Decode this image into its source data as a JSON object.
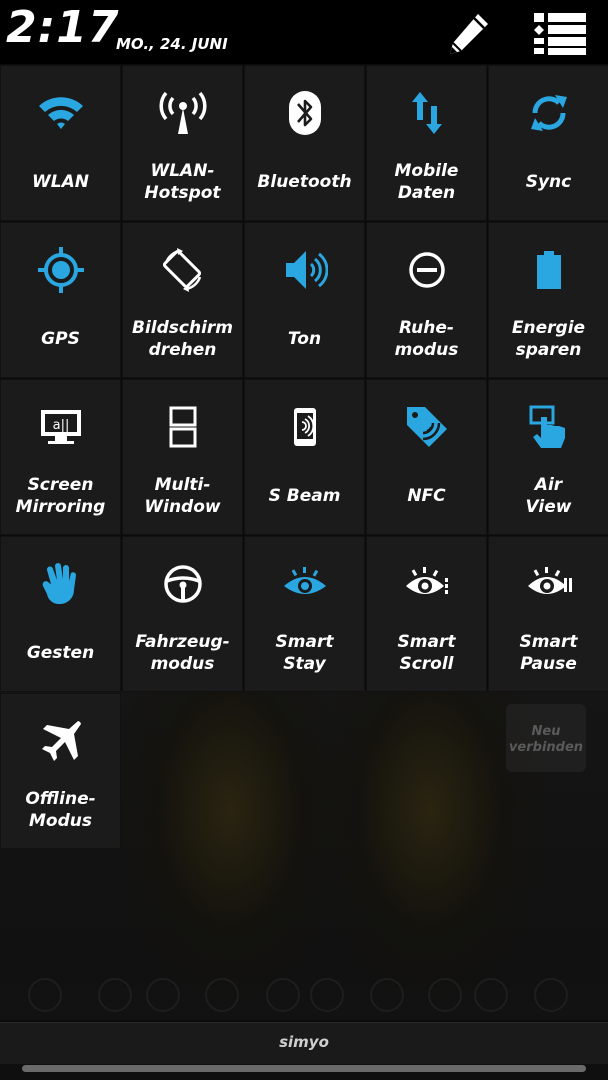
{
  "status": {
    "time": "2:17",
    "date": "MO., 24. JUNI"
  },
  "colors": {
    "accent": "#2aa6e0",
    "icon_white": "#ffffff",
    "tile_bg": "#1b1b1b"
  },
  "toggles": [
    {
      "label": "WLAN",
      "icon": "wifi-icon",
      "active": true
    },
    {
      "label": "WLAN-\nHotspot",
      "icon": "hotspot-icon",
      "active": false
    },
    {
      "label": "Bluetooth",
      "icon": "bluetooth-icon",
      "active": false
    },
    {
      "label": "Mobile\nDaten",
      "icon": "mobile-data-icon",
      "active": true
    },
    {
      "label": "Sync",
      "icon": "sync-icon",
      "active": true
    },
    {
      "label": "GPS",
      "icon": "gps-icon",
      "active": true
    },
    {
      "label": "Bildschirm\ndrehen",
      "icon": "rotate-icon",
      "active": false
    },
    {
      "label": "Ton",
      "icon": "sound-icon",
      "active": true
    },
    {
      "label": "Ruhe-\nmodus",
      "icon": "blocking-mode-icon",
      "active": false
    },
    {
      "label": "Energie\nsparen",
      "icon": "battery-icon",
      "active": true
    },
    {
      "label": "Screen\nMirroring",
      "icon": "screen-mirroring-icon",
      "active": false
    },
    {
      "label": "Multi-\nWindow",
      "icon": "multi-window-icon",
      "active": false
    },
    {
      "label": "S Beam",
      "icon": "s-beam-icon",
      "active": false
    },
    {
      "label": "NFC",
      "icon": "nfc-icon",
      "active": true
    },
    {
      "label": "Air\nView",
      "icon": "air-view-icon",
      "active": true
    },
    {
      "label": "Gesten",
      "icon": "gesture-hand-icon",
      "active": true
    },
    {
      "label": "Fahrzeug-\nmodus",
      "icon": "steering-wheel-icon",
      "active": false
    },
    {
      "label": "Smart\nStay",
      "icon": "smart-stay-eye-icon",
      "active": true
    },
    {
      "label": "Smart\nScroll",
      "icon": "smart-scroll-eye-icon",
      "active": false
    },
    {
      "label": "Smart\nPause",
      "icon": "smart-pause-eye-icon",
      "active": false
    },
    {
      "label": "Offline-\nModus",
      "icon": "airplane-icon",
      "active": false
    }
  ],
  "wallpaper_badge": "Neu\nverbinden",
  "carrier": "simyo"
}
